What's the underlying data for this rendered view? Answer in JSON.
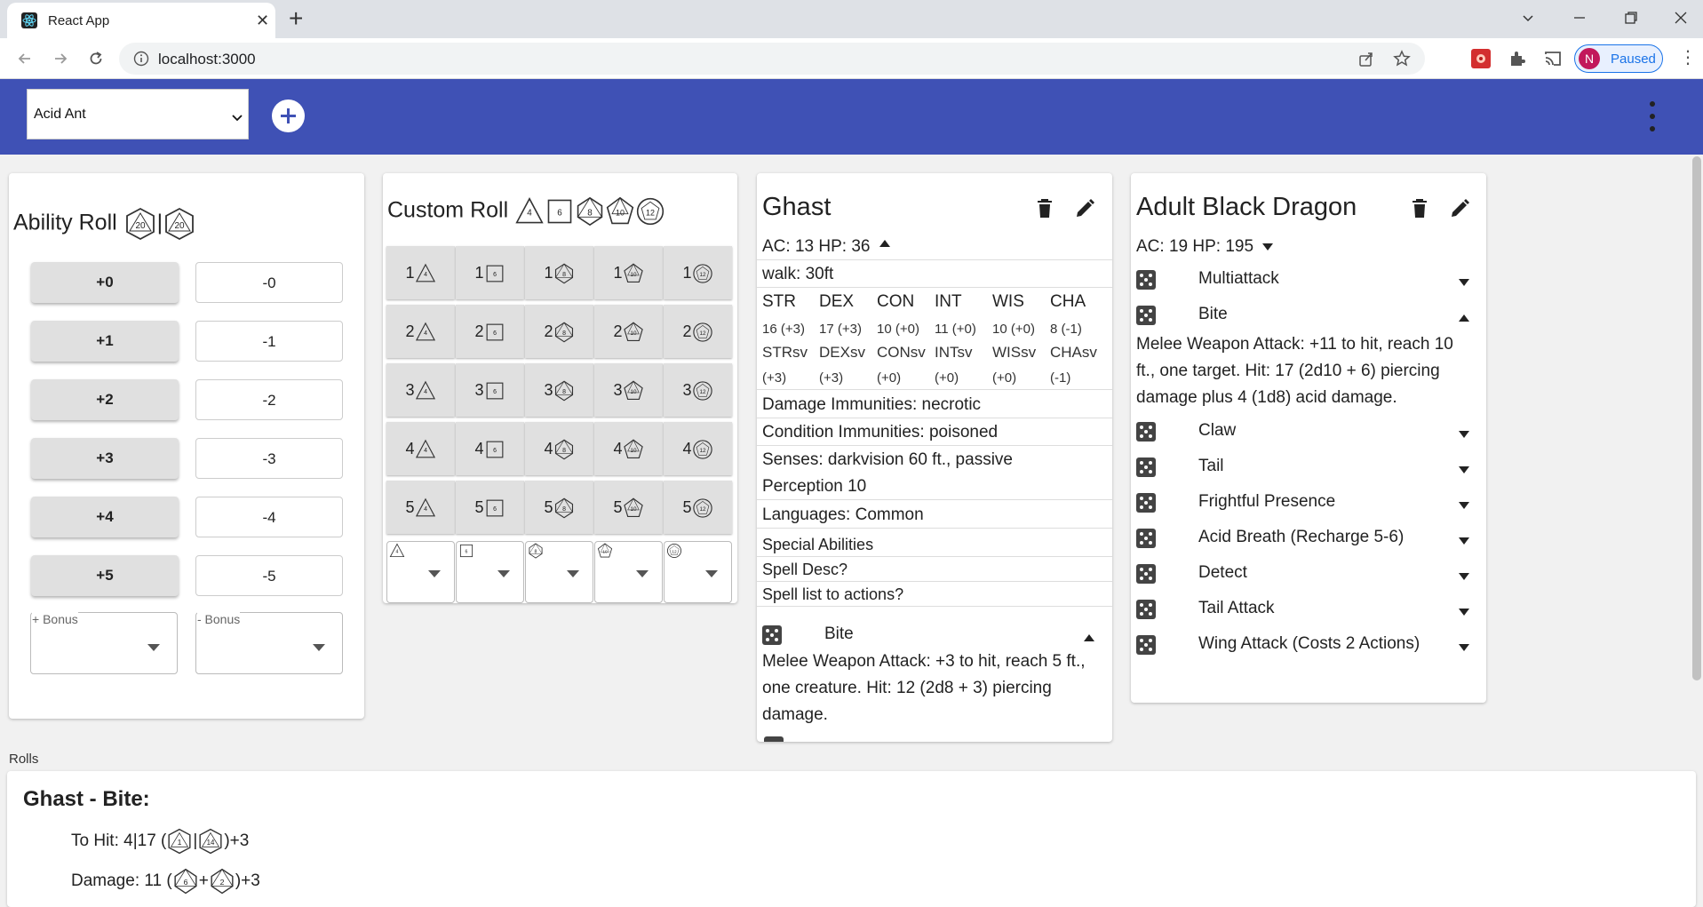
{
  "browser": {
    "tab_title": "React App",
    "url": "localhost:3000",
    "profile_initial": "N",
    "profile_status": "Paused"
  },
  "appbar": {
    "selected_monster": "Acid Ant"
  },
  "ability_roll": {
    "title": "Ability Roll",
    "dice_icons": [
      "20",
      "20"
    ],
    "plus_buttons": [
      "+0",
      "+1",
      "+2",
      "+3",
      "+4",
      "+5"
    ],
    "minus_buttons": [
      "-0",
      "-1",
      "-2",
      "-3",
      "-4",
      "-5"
    ],
    "bonus_plus_label": "+ Bonus",
    "bonus_minus_label": "- Bonus"
  },
  "custom_roll": {
    "title": "Custom Roll",
    "dice_types": [
      "4",
      "6",
      "8",
      "10",
      "12"
    ],
    "counts": [
      "1",
      "2",
      "3",
      "4",
      "5"
    ]
  },
  "ghast": {
    "name": "Ghast",
    "ac_hp": "AC: 13 HP: 36",
    "speed": "walk: 30ft",
    "stat_names": [
      "STR",
      "DEX",
      "CON",
      "INT",
      "WIS",
      "CHA"
    ],
    "stat_values": [
      "16 (+3)",
      "17 (+3)",
      "10 (+0)",
      "11 (+0)",
      "10 (+0)",
      "8 (-1)"
    ],
    "save_names": [
      "STRsv",
      "DEXsv",
      "CONsv",
      "INTsv",
      "WISsv",
      "CHAsv"
    ],
    "save_values": [
      "(+3)",
      "(+3)",
      "(+0)",
      "(+0)",
      "(+0)",
      "(-1)"
    ],
    "damage_immunities": "Damage Immunities: necrotic",
    "condition_immunities": "Condition Immunities: poisoned",
    "senses_line1": "Senses: darkvision 60 ft., passive",
    "senses_line2": "Perception 10",
    "languages": "Languages: Common",
    "special_abilities": "Special Abilities",
    "spell_desc": "Spell Desc?",
    "spell_list": "Spell list to actions?",
    "action_name": "Bite",
    "action_desc": [
      "Melee Weapon Attack: +3 to hit, reach 5 ft.,",
      "one creature. Hit: 12 (2d8 + 3) piercing",
      "damage."
    ]
  },
  "dragon": {
    "name": "Adult Black Dragon",
    "ac_hp": "AC: 19 HP: 195",
    "actions": [
      "Multiattack",
      "Bite",
      "Claw",
      "Tail",
      "Frightful Presence",
      "Acid Breath (Recharge 5-6)",
      "Detect",
      "Tail Attack",
      "Wing Attack (Costs 2 Actions)"
    ],
    "bite_desc": [
      "Melee Weapon Attack: +11 to hit, reach 10",
      "ft., one target. Hit: 17 (2d10 + 6) piercing",
      "damage plus 4 (1d8) acid damage."
    ]
  },
  "rolls": {
    "label": "Rolls",
    "title": "Ghast - Bite:",
    "to_hit_prefix": "To Hit: 4|17 (",
    "to_hit_die1": "1",
    "to_hit_sep": "|",
    "to_hit_die2": "14",
    "to_hit_suffix": ")+3",
    "damage_prefix": "Damage: 11 (",
    "damage_die1": "6",
    "damage_plus": "+",
    "damage_die2": "2",
    "damage_suffix": ")+3"
  }
}
